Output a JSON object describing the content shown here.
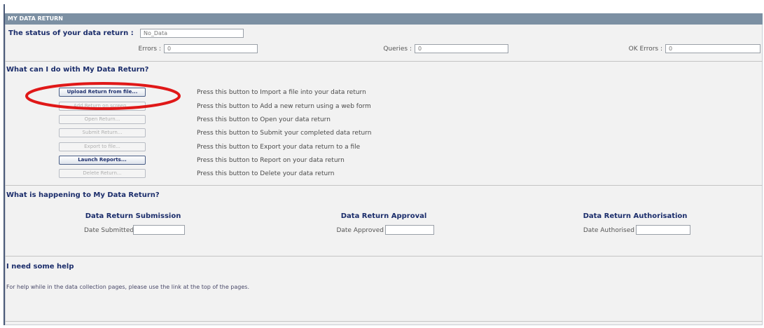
{
  "header": {
    "title": "MY DATA RETURN"
  },
  "status": {
    "label": "The status of your data return :",
    "value": "No_Data",
    "errors_label": "Errors :",
    "errors_value": "0",
    "queries_label": "Queries :",
    "queries_value": "0",
    "ok_errors_label": "OK Errors :",
    "ok_errors_value": "0"
  },
  "actions": {
    "heading": "What can I do with My Data Return?",
    "buttons": [
      {
        "label": "Upload Return from file...",
        "description": "Press this button to Import a file into your data return",
        "enabled": true,
        "highlighted": true
      },
      {
        "label": "Add Return on screen...",
        "description": "Press this button to Add a new return using a web form",
        "enabled": false
      },
      {
        "label": "Open Return...",
        "description": "Press this button to Open your data return",
        "enabled": false
      },
      {
        "label": "Submit Return...",
        "description": "Press this button to Submit your completed data return",
        "enabled": false
      },
      {
        "label": "Export to file...",
        "description": "Press this button to Export your data return to a file",
        "enabled": false
      },
      {
        "label": "Launch Reports...",
        "description": "Press this button to Report on your data return",
        "enabled": true
      },
      {
        "label": "Delete Return...",
        "description": "Press this button to Delete your data return",
        "enabled": false
      }
    ]
  },
  "progress": {
    "heading": "What is happening to My Data Return?",
    "submission": {
      "title": "Data Return Submission",
      "field_label": "Date Submitted",
      "value": ""
    },
    "approval": {
      "title": "Data Return Approval",
      "field_label": "Date Approved",
      "value": ""
    },
    "authorisation": {
      "title": "Data Return Authorisation",
      "field_label": "Date Authorised",
      "value": ""
    }
  },
  "help": {
    "heading": "I need some help",
    "text": "For help while in the data collection pages, please use the link at the top of the pages."
  },
  "colors": {
    "header_bar": "#7c90a3",
    "heading_text": "#1b2d6b",
    "highlight_ellipse": "#e01818"
  }
}
